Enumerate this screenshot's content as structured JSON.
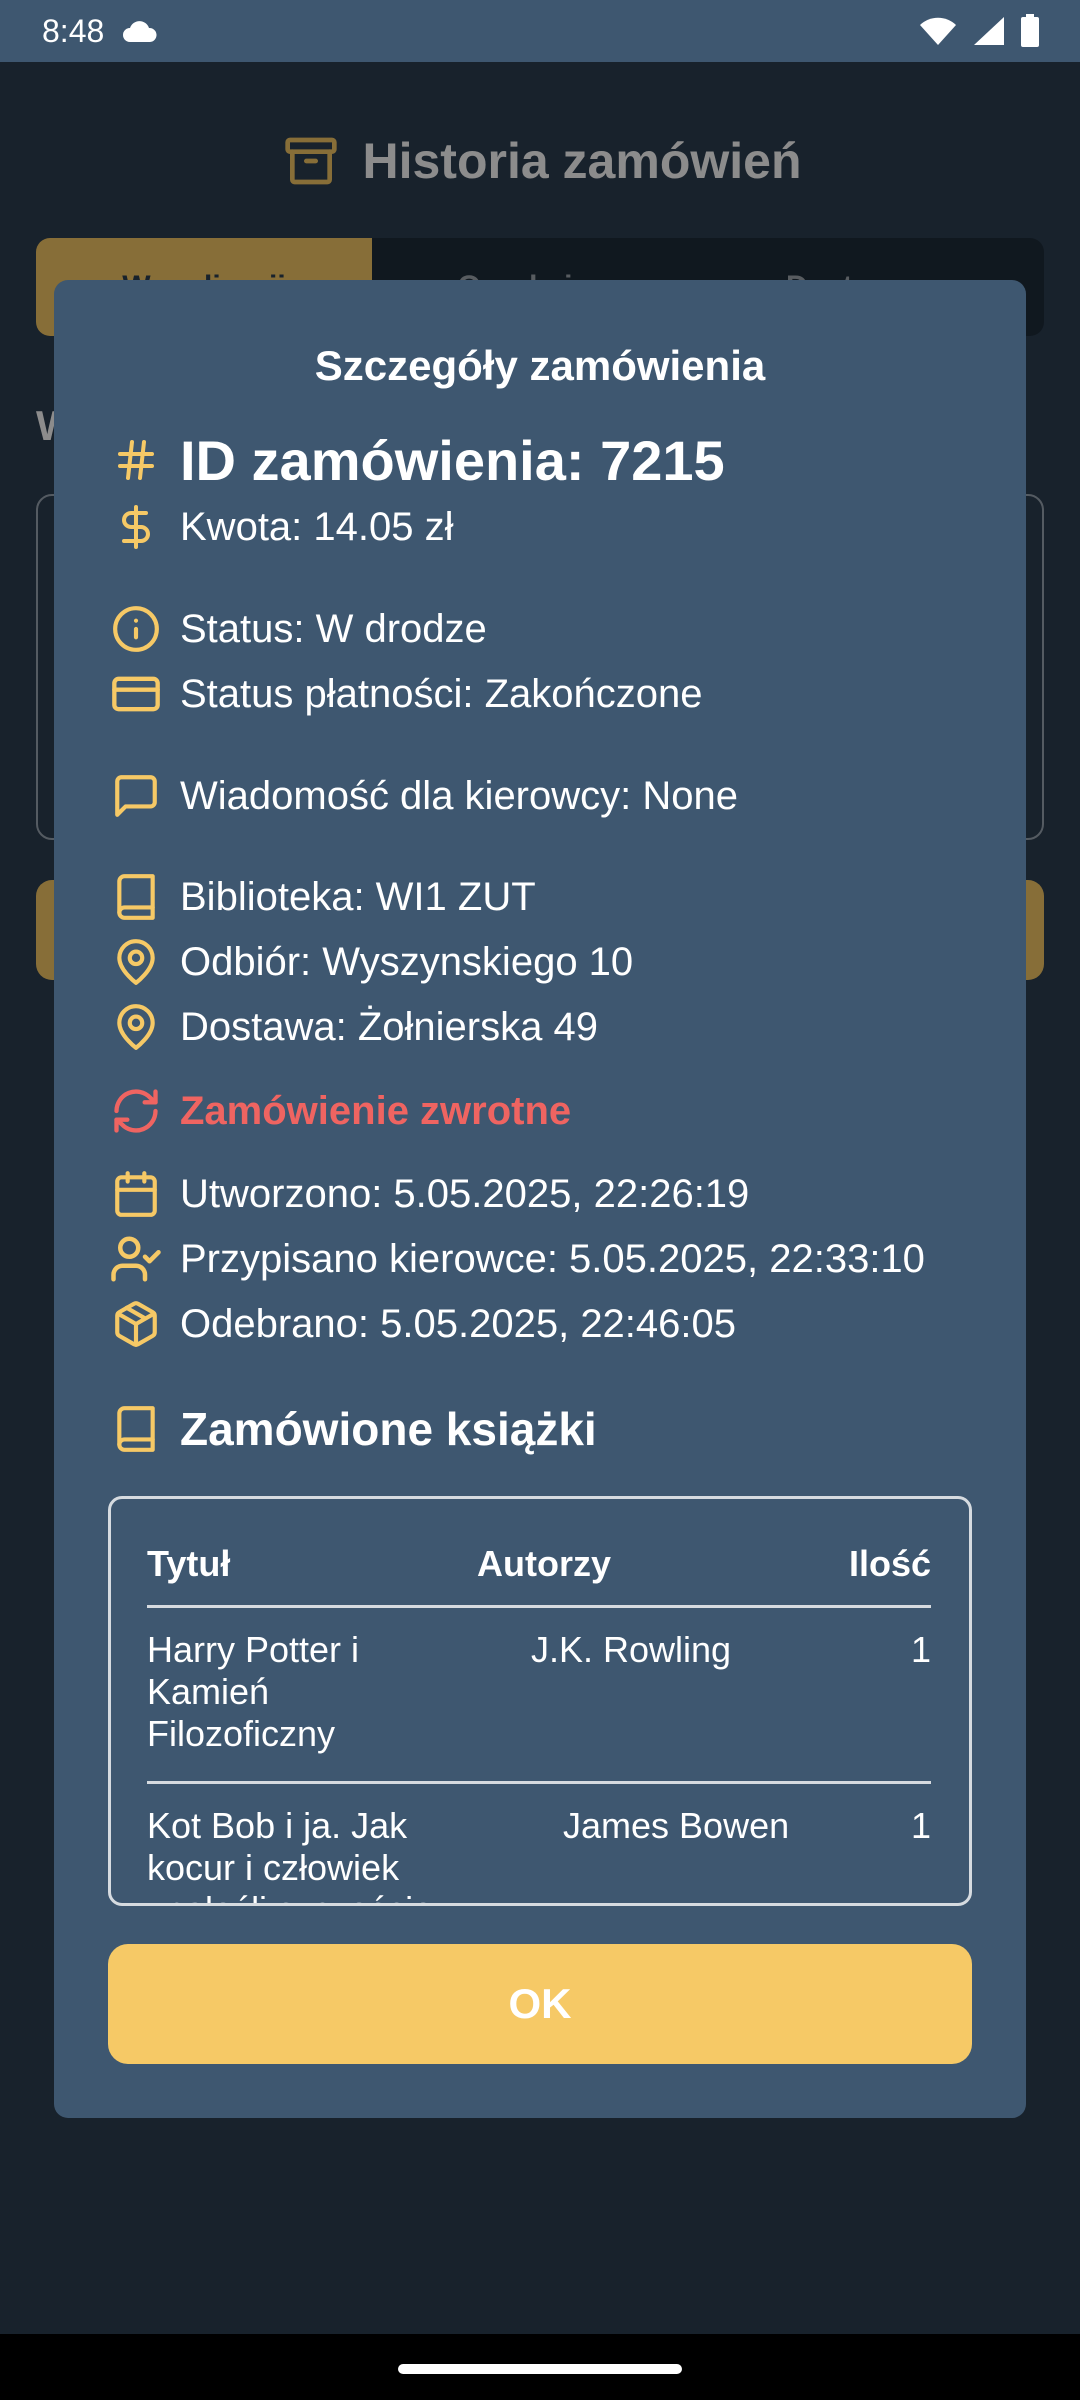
{
  "status_bar": {
    "time": "8:48"
  },
  "background": {
    "title": "Historia zamówień",
    "tabs": [
      "W realizacji",
      "Oczekujące",
      "Dostarczone"
    ],
    "section_title": "W"
  },
  "dialog": {
    "title": "Szczegóły zamówienia",
    "order_id": "ID zamówienia: 7215",
    "amount": "Kwota: 14.05 zł",
    "status": "Status: W drodze",
    "payment_status": "Status płatności: Zakończone",
    "driver_message": "Wiadomość dla kierowcy: None",
    "library": "Biblioteka: WI1 ZUT",
    "pickup": "Odbiór: Wyszynskiego 10",
    "delivery": "Dostawa: Żołnierska 49",
    "return_order": "Zamówienie zwrotne",
    "created": "Utworzono: 5.05.2025, 22:26:19",
    "assigned": "Przypisano kierowce: 5.05.2025, 22:33:10",
    "picked_up": "Odebrano: 5.05.2025, 22:46:05",
    "books_heading": "Zamówione książki",
    "table": {
      "headers": {
        "title": "Tytuł",
        "authors": "Autorzy",
        "qty": "Ilość"
      },
      "rows": [
        {
          "title": "Harry Potter i Kamień Filozoficzny",
          "authors": "J.K. Rowling",
          "qty": "1"
        },
        {
          "title": "Kot Bob i ja. Jak kocur i człowiek znaleźli szczęście",
          "authors": "James Bowen",
          "qty": "1"
        }
      ]
    },
    "ok_label": "OK"
  },
  "colors": {
    "accent": "#f6c966",
    "dialog_bg": "#3e5770",
    "return_red": "#ef6461"
  }
}
